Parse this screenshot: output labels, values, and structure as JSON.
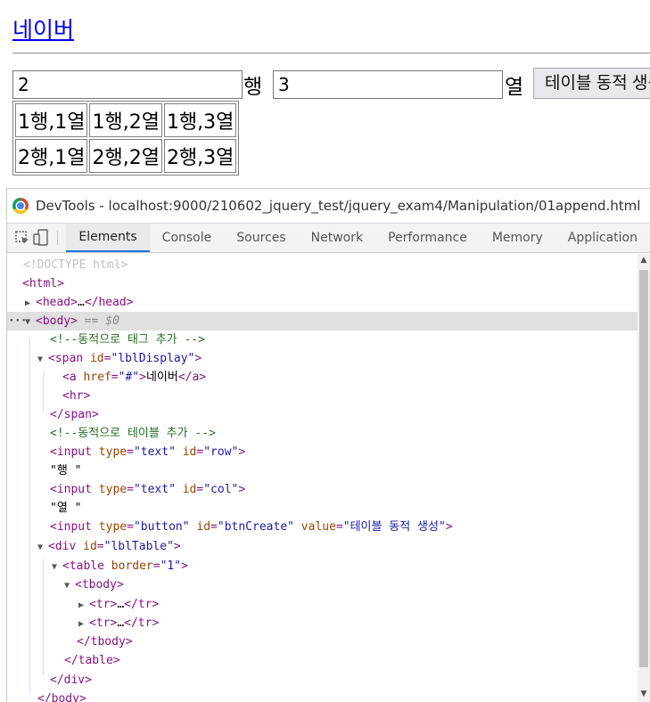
{
  "page": {
    "link_text": "네이버",
    "row_value": "2",
    "row_unit": "행",
    "col_value": "3",
    "col_unit": "열",
    "button_label": "테이블 동적 생성",
    "table": [
      [
        "1행,1열",
        "1행,2열",
        "1행,3열"
      ],
      [
        "2행,1열",
        "2행,2열",
        "2행,3열"
      ]
    ]
  },
  "devtools": {
    "title": "DevTools - localhost:9000/210602_jquery_test/jquery_exam4/Manipulation/01append.html",
    "tabs": [
      "Elements",
      "Console",
      "Sources",
      "Network",
      "Performance",
      "Memory",
      "Application"
    ],
    "active_tab": "Elements",
    "accent_color": "#1a73e8",
    "dom": {
      "doctype": "<!DOCTYPE html>",
      "html": "html",
      "head_collapsed": "…",
      "body_ref": "== $0",
      "comment1": "<!--동적으로 태그 추가 -->",
      "span_id": "\"lblDisplay\"",
      "a_href": "\"#\"",
      "a_text": "네이버",
      "comment2": "<!--동적으로 테이블 추가 -->",
      "input_type_text": "\"text\"",
      "input1_id": "\"row\"",
      "text_row": "\"행 \"",
      "input2_id": "\"col\"",
      "text_col": "\"열 \"",
      "input_type_button": "\"button\"",
      "input3_id": "\"btnCreate\"",
      "input3_value": "\"테이블 동적 생성\"",
      "div_id": "\"lblTable\"",
      "table_border": "\"1\"",
      "tr_collapsed": "…"
    }
  }
}
